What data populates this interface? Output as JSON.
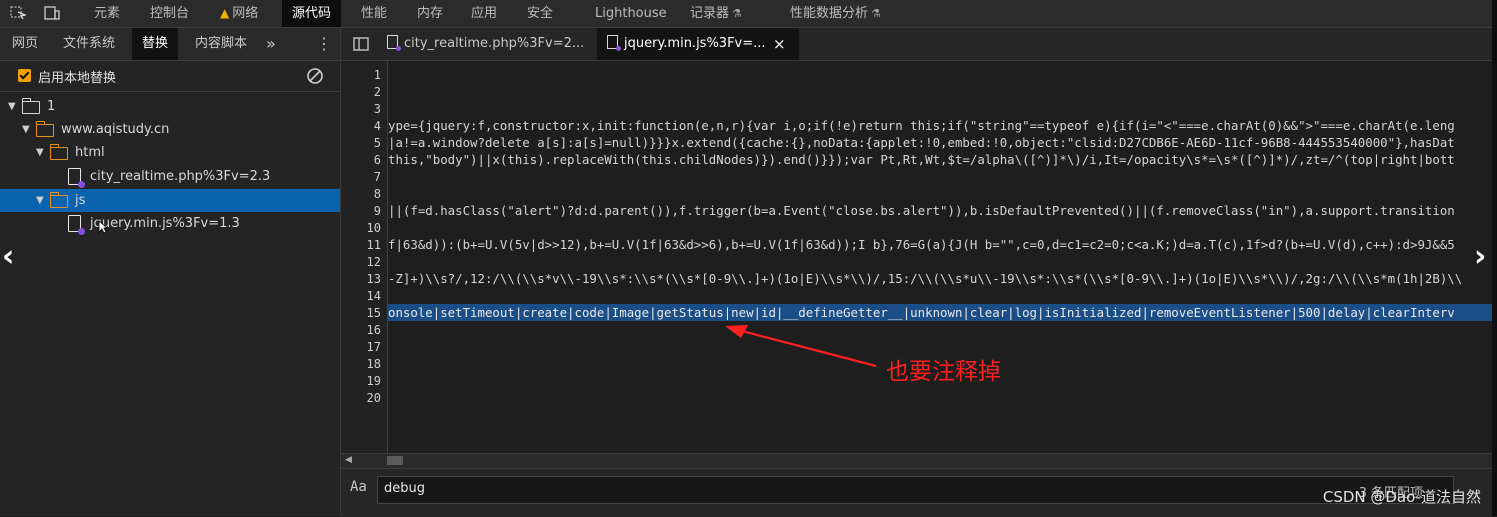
{
  "devtools_tabs": [
    {
      "label": "元素"
    },
    {
      "label": "控制台"
    },
    {
      "label": "网络",
      "icon": "warning-icon"
    },
    {
      "label": "源代码",
      "active": true
    },
    {
      "label": "性能"
    },
    {
      "label": "内存"
    },
    {
      "label": "应用"
    },
    {
      "label": "安全"
    },
    {
      "label": "Lighthouse"
    },
    {
      "label": "记录器",
      "icon": "flask-icon"
    },
    {
      "label": "性能数据分析",
      "icon": "flask-icon"
    }
  ],
  "navigator": {
    "tabs": [
      "网页",
      "文件系统",
      "替换",
      "内容脚本"
    ],
    "more": "»",
    "menu": "⋮",
    "enable_overrides_label": "启用本地替换",
    "tree": {
      "root": "1",
      "domain": "www.aqistudy.cn",
      "html_folder": "html",
      "html_file": "city_realtime.php%3Fv=2.3",
      "js_folder": "js",
      "js_file": "jquery.min.js%3Fv=1.3"
    }
  },
  "editor": {
    "tabs": [
      "city_realtime.php%3Fv=2...",
      "jquery.min.js%3Fv=..."
    ],
    "close": "×",
    "line_numbers": [
      "1",
      "2",
      "3",
      "4",
      "5",
      "6",
      "7",
      "8",
      "9",
      "10",
      "11",
      "12",
      "13",
      "14",
      "15",
      "16",
      "17",
      "18",
      "19",
      "20"
    ],
    "lines": {
      "l4": "ype={jquery:f,constructor:x,init:function(e,n,r){var i,o;if(!e)return this;if(\"string\"==typeof e){if(i=\"<\"===e.charAt(0)&&\">\"===e.charAt(e.leng",
      "l5": "|a!=a.window?delete a[s]:a[s]=null)}}}x.extend({cache:{},noData:{applet:!0,embed:!0,object:\"clsid:D27CDB6E-AE6D-11cf-96B8-444553540000\"},hasDat",
      "l6": "this,\"body\")||x(this).replaceWith(this.childNodes)}).end()}});var Pt,Rt,Wt,$t=/alpha\\([^)]*\\)/i,It=/opacity\\s*=\\s*([^)]*)/,zt=/^(top|right|bott",
      "l9": "||(f=d.hasClass(\"alert\")?d:d.parent()),f.trigger(b=a.Event(\"close.bs.alert\")),b.isDefaultPrevented()||(f.removeClass(\"in\"),a.support.transition",
      "l11": "f|63&d)):(b+=U.V(5v|d>>12),b+=U.V(1f|63&d>>6),b+=U.V(1f|63&d));I b},76=G(a){J(H b=\"\",c=0,d=c1=c2=0;c<a.K;)d=a.T(c),1f>d?(b+=U.V(d),c++):d>9J&&5",
      "l13": "-Z]+)\\\\s?/,12:/\\\\(\\\\s*v\\\\-19\\\\s*:\\\\s*(\\\\s*[0-9\\\\.]+)(1o|E)\\\\s*\\\\)/,15:/\\\\(\\\\s*u\\\\-19\\\\s*:\\\\s*(\\\\s*[0-9\\\\.]+)(1o|E)\\\\s*\\\\)/,2g:/\\\\(\\\\s*m(1h|2B)\\\\",
      "l15": "onsole|setTimeout|create|code|Image|getStatus|new|id|__defineGetter__|unknown|clear|log|isInitialized|removeEventListener|500|delay|clearInterv"
    }
  },
  "annotation": "也要注释掉",
  "search": {
    "value": "debug",
    "match_count": "3 条匹配项"
  },
  "watermark": "CSDN @Dao-道法自然",
  "colors": {
    "accent_selected": "#0b62ad",
    "annotation_red": "#ff1f1f",
    "folder_orange": "#e8901f",
    "checkbox_orange": "#f0a000"
  }
}
